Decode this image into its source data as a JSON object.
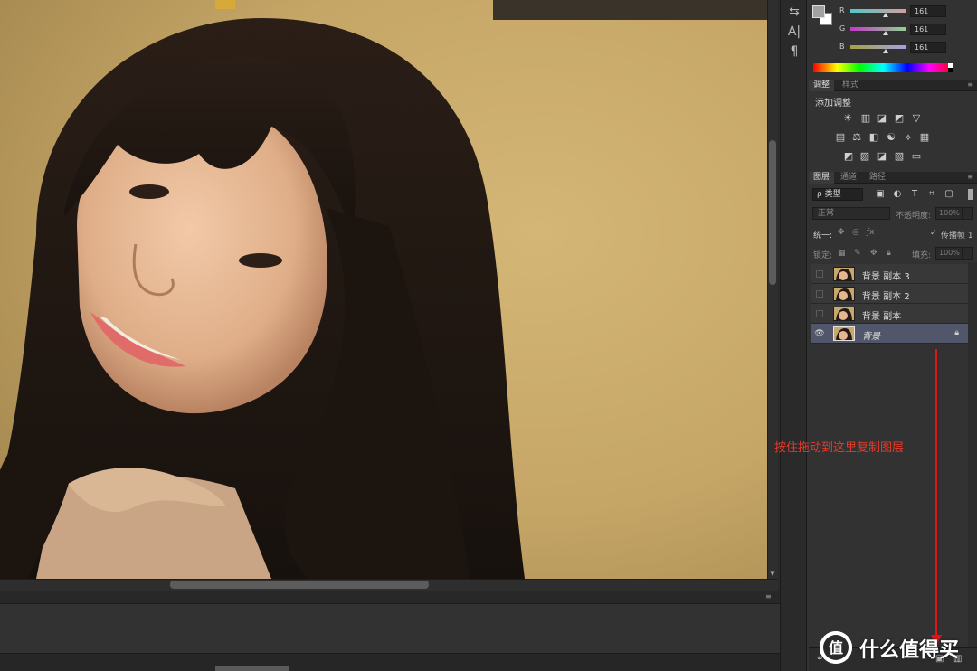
{
  "color_panel": {
    "foreground_color": "#a1a1a1",
    "background_color": "#ffffff",
    "channels": [
      {
        "label": "R",
        "value": "161",
        "gradient_from": "#a1ffff",
        "gradient_to": "#a1a1a1"
      },
      {
        "label": "G",
        "value": "161",
        "gradient_from": "#ff00ff",
        "gradient_to": "#a1ffa1"
      },
      {
        "label": "B",
        "value": "161",
        "gradient_from": "#a1a100",
        "gradient_to": "#a1a1ff"
      }
    ]
  },
  "tools": {
    "items": [
      {
        "icon": "swap-colors-icon",
        "glyph": "⇆"
      },
      {
        "icon": "character-icon",
        "glyph": "A|"
      },
      {
        "icon": "paragraph-icon",
        "glyph": "¶"
      }
    ]
  },
  "adjustments_panel": {
    "tabs": [
      "调整",
      "样式"
    ],
    "title": "添加调整",
    "menu_glyph": "≡",
    "rows": [
      [
        "☀",
        "▥",
        "◪",
        "◩",
        "▽"
      ],
      [
        "▤",
        "⚖",
        "◧",
        "☯",
        "⟡",
        "▦"
      ],
      [
        "◩",
        "▨",
        "◪",
        "▧",
        "▭"
      ]
    ]
  },
  "layers_panel": {
    "tabs": [
      "图层",
      "通道",
      "路径"
    ],
    "menu_glyph": "≡",
    "filter": {
      "label": "ρ 类型"
    },
    "filter_icons": [
      "▣",
      "◐",
      "T",
      "⌗",
      "▢"
    ],
    "blend_mode": "正常",
    "opacity_label": "不透明度:",
    "opacity_value": "100%",
    "unify_label": "统一:",
    "propagate_label": "传播帧 1",
    "lock_label": "锁定:",
    "fill_label": "填充:",
    "fill_value": "100%",
    "layers": [
      {
        "name": "背景 副本 3",
        "visible": false,
        "selected": false,
        "locked": false
      },
      {
        "name": "背景 副本 2",
        "visible": false,
        "selected": false,
        "locked": false
      },
      {
        "name": "背景 副本",
        "visible": false,
        "selected": false,
        "locked": false
      },
      {
        "name": "背景",
        "visible": true,
        "selected": true,
        "locked": true
      }
    ]
  },
  "annotation": {
    "text": "按住拖动到这里复制图层",
    "color": "#e01515"
  },
  "watermark": {
    "logo_glyph": "值",
    "text": "什么值得买"
  },
  "bottom_panel": {
    "menu_glyph": "≡"
  }
}
